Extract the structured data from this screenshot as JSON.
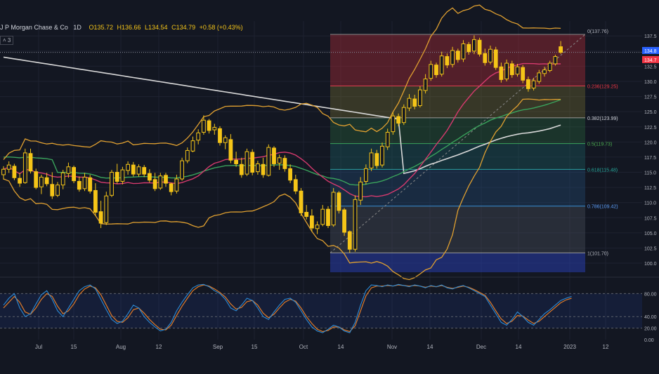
{
  "header": {
    "symbol": "J P Morgan Chase & Co",
    "interval": "1D",
    "open": "O135.72",
    "high": "H136.66",
    "low": "L134.54",
    "close": "C134.79",
    "change": "+0.58 (+0.43%)",
    "indicator_toggle": "˄ 3"
  },
  "colors": {
    "background": "#131722",
    "candle": "#f5c518",
    "bollinger": "#e0a030",
    "ma_fast": "#d63a6e",
    "ma_mid": "#3aa35c",
    "ma_slow": "#d8d8d8",
    "stoch_k": "#2d8bd6",
    "stoch_d": "#e07b2a",
    "price_tag_blue": "#2962ff",
    "price_tag_red": "#f23645"
  },
  "chart_data": [
    {
      "type": "candlestick",
      "title": "",
      "x_tick_labels": [
        "Jul",
        "15",
        "Aug",
        "12",
        "Sep",
        "15",
        "Oct",
        "14",
        "Nov",
        "14",
        "Dec",
        "14",
        "2023",
        "12"
      ],
      "y_tick_labels": [
        "100.0",
        "102.5",
        "105.0",
        "107.5",
        "110.0",
        "112.5",
        "115.0",
        "117.5",
        "120.0",
        "122.5",
        "125.0",
        "127.5",
        "130.0",
        "132.5",
        "135.0",
        "137.5"
      ],
      "ylim": [
        98.5,
        138.8
      ],
      "candles": [
        {
          "o": 114.6,
          "h": 116.0,
          "l": 113.8,
          "c": 115.5
        },
        {
          "o": 115.5,
          "h": 116.8,
          "l": 114.9,
          "c": 116.2
        },
        {
          "o": 116.0,
          "h": 116.4,
          "l": 113.7,
          "c": 114.1
        },
        {
          "o": 114.0,
          "h": 114.9,
          "l": 112.6,
          "c": 113.2
        },
        {
          "o": 113.3,
          "h": 118.9,
          "l": 113.1,
          "c": 118.2
        },
        {
          "o": 118.1,
          "h": 118.9,
          "l": 114.8,
          "c": 115.2
        },
        {
          "o": 115.1,
          "h": 115.6,
          "l": 112.2,
          "c": 112.5
        },
        {
          "o": 112.6,
          "h": 114.6,
          "l": 111.4,
          "c": 114.2
        },
        {
          "o": 114.1,
          "h": 114.9,
          "l": 112.7,
          "c": 113.1
        },
        {
          "o": 113.0,
          "h": 115.0,
          "l": 110.6,
          "c": 111.1
        },
        {
          "o": 111.2,
          "h": 113.4,
          "l": 110.9,
          "c": 112.9
        },
        {
          "o": 112.9,
          "h": 115.4,
          "l": 112.2,
          "c": 114.9
        },
        {
          "o": 114.8,
          "h": 116.6,
          "l": 114.1,
          "c": 115.9
        },
        {
          "o": 115.8,
          "h": 116.1,
          "l": 113.2,
          "c": 113.6
        },
        {
          "o": 113.5,
          "h": 114.3,
          "l": 111.8,
          "c": 112.2
        },
        {
          "o": 112.3,
          "h": 114.9,
          "l": 111.9,
          "c": 114.2
        },
        {
          "o": 114.1,
          "h": 114.6,
          "l": 111.5,
          "c": 111.9
        },
        {
          "o": 112.0,
          "h": 113.2,
          "l": 107.8,
          "c": 108.4
        },
        {
          "o": 108.5,
          "h": 110.3,
          "l": 105.8,
          "c": 106.6
        },
        {
          "o": 106.7,
          "h": 111.8,
          "l": 106.3,
          "c": 111.1
        },
        {
          "o": 111.2,
          "h": 115.4,
          "l": 110.9,
          "c": 115.0
        },
        {
          "o": 115.0,
          "h": 116.4,
          "l": 113.1,
          "c": 113.5
        },
        {
          "o": 113.5,
          "h": 115.9,
          "l": 113.0,
          "c": 115.4
        },
        {
          "o": 115.3,
          "h": 116.8,
          "l": 114.6,
          "c": 116.3
        },
        {
          "o": 116.2,
          "h": 116.7,
          "l": 114.3,
          "c": 114.7
        },
        {
          "o": 114.7,
          "h": 116.3,
          "l": 114.3,
          "c": 115.9
        },
        {
          "o": 115.8,
          "h": 116.2,
          "l": 114.2,
          "c": 114.7
        },
        {
          "o": 114.8,
          "h": 115.5,
          "l": 113.3,
          "c": 113.7
        },
        {
          "o": 113.8,
          "h": 114.9,
          "l": 111.9,
          "c": 112.3
        },
        {
          "o": 112.4,
          "h": 114.9,
          "l": 112.1,
          "c": 114.4
        },
        {
          "o": 114.5,
          "h": 114.9,
          "l": 112.6,
          "c": 113.2
        },
        {
          "o": 113.1,
          "h": 113.3,
          "l": 111.2,
          "c": 111.8
        },
        {
          "o": 111.9,
          "h": 114.6,
          "l": 111.5,
          "c": 113.9
        },
        {
          "o": 113.9,
          "h": 117.4,
          "l": 113.6,
          "c": 116.9
        },
        {
          "o": 116.9,
          "h": 119.1,
          "l": 116.5,
          "c": 118.6
        },
        {
          "o": 118.5,
          "h": 120.9,
          "l": 118.3,
          "c": 120.2
        },
        {
          "o": 120.3,
          "h": 122.1,
          "l": 119.6,
          "c": 121.5
        },
        {
          "o": 121.6,
          "h": 124.4,
          "l": 121.2,
          "c": 123.6
        },
        {
          "o": 123.5,
          "h": 123.8,
          "l": 121.4,
          "c": 121.9
        },
        {
          "o": 122.0,
          "h": 123.0,
          "l": 121.2,
          "c": 122.4
        },
        {
          "o": 122.2,
          "h": 122.6,
          "l": 119.4,
          "c": 119.9
        },
        {
          "o": 119.9,
          "h": 121.1,
          "l": 118.8,
          "c": 120.7
        },
        {
          "o": 120.4,
          "h": 121.3,
          "l": 116.5,
          "c": 117.0
        },
        {
          "o": 117.0,
          "h": 118.4,
          "l": 115.9,
          "c": 116.4
        },
        {
          "o": 116.3,
          "h": 117.4,
          "l": 114.1,
          "c": 114.6
        },
        {
          "o": 114.7,
          "h": 118.9,
          "l": 114.4,
          "c": 118.4
        },
        {
          "o": 118.3,
          "h": 118.8,
          "l": 114.5,
          "c": 115.0
        },
        {
          "o": 115.1,
          "h": 116.9,
          "l": 114.6,
          "c": 116.4
        },
        {
          "o": 116.3,
          "h": 117.4,
          "l": 114.1,
          "c": 114.6
        },
        {
          "o": 114.5,
          "h": 119.6,
          "l": 114.3,
          "c": 119.1
        },
        {
          "o": 119.0,
          "h": 119.3,
          "l": 115.9,
          "c": 116.4
        },
        {
          "o": 116.5,
          "h": 117.9,
          "l": 115.4,
          "c": 117.4
        },
        {
          "o": 117.3,
          "h": 117.8,
          "l": 115.1,
          "c": 115.6
        },
        {
          "o": 115.6,
          "h": 116.3,
          "l": 113.2,
          "c": 113.7
        },
        {
          "o": 113.8,
          "h": 114.6,
          "l": 111.4,
          "c": 111.9
        },
        {
          "o": 111.9,
          "h": 112.4,
          "l": 107.8,
          "c": 108.3
        },
        {
          "o": 108.4,
          "h": 109.6,
          "l": 107.2,
          "c": 107.7
        },
        {
          "o": 107.8,
          "h": 108.9,
          "l": 105.2,
          "c": 105.8
        },
        {
          "o": 105.7,
          "h": 106.9,
          "l": 104.8,
          "c": 106.3
        },
        {
          "o": 106.4,
          "h": 109.6,
          "l": 106.1,
          "c": 108.9
        },
        {
          "o": 108.9,
          "h": 109.4,
          "l": 105.8,
          "c": 106.2
        },
        {
          "o": 106.3,
          "h": 112.4,
          "l": 106.0,
          "c": 111.7
        },
        {
          "o": 111.6,
          "h": 111.9,
          "l": 108.2,
          "c": 108.7
        },
        {
          "o": 108.8,
          "h": 109.1,
          "l": 104.5,
          "c": 105.1
        },
        {
          "o": 105.2,
          "h": 105.4,
          "l": 101.7,
          "c": 102.3
        },
        {
          "o": 102.3,
          "h": 111.2,
          "l": 101.9,
          "c": 110.5
        },
        {
          "o": 110.4,
          "h": 114.2,
          "l": 109.6,
          "c": 113.4
        },
        {
          "o": 113.5,
          "h": 116.3,
          "l": 113.0,
          "c": 115.6
        },
        {
          "o": 115.7,
          "h": 118.9,
          "l": 115.2,
          "c": 118.2
        },
        {
          "o": 118.1,
          "h": 118.7,
          "l": 115.6,
          "c": 116.1
        },
        {
          "o": 116.2,
          "h": 119.9,
          "l": 115.8,
          "c": 119.3
        },
        {
          "o": 119.2,
          "h": 122.2,
          "l": 118.7,
          "c": 121.6
        },
        {
          "o": 121.7,
          "h": 124.9,
          "l": 121.2,
          "c": 124.3
        },
        {
          "o": 124.2,
          "h": 124.7,
          "l": 122.6,
          "c": 123.1
        },
        {
          "o": 123.2,
          "h": 126.2,
          "l": 122.8,
          "c": 125.7
        },
        {
          "o": 125.6,
          "h": 127.9,
          "l": 125.1,
          "c": 127.2
        },
        {
          "o": 127.1,
          "h": 127.8,
          "l": 125.4,
          "c": 125.9
        },
        {
          "o": 126.0,
          "h": 129.2,
          "l": 125.7,
          "c": 128.6
        },
        {
          "o": 128.5,
          "h": 131.2,
          "l": 128.0,
          "c": 130.4
        },
        {
          "o": 130.5,
          "h": 133.4,
          "l": 130.1,
          "c": 132.8
        },
        {
          "o": 132.7,
          "h": 133.1,
          "l": 130.6,
          "c": 131.1
        },
        {
          "o": 131.2,
          "h": 134.9,
          "l": 130.8,
          "c": 134.2
        },
        {
          "o": 134.1,
          "h": 134.6,
          "l": 132.2,
          "c": 132.7
        },
        {
          "o": 132.8,
          "h": 135.7,
          "l": 132.3,
          "c": 135.1
        },
        {
          "o": 135.0,
          "h": 135.4,
          "l": 133.1,
          "c": 133.6
        },
        {
          "o": 133.7,
          "h": 136.8,
          "l": 133.2,
          "c": 136.2
        },
        {
          "o": 136.1,
          "h": 136.5,
          "l": 134.4,
          "c": 134.9
        },
        {
          "o": 135.0,
          "h": 137.6,
          "l": 134.5,
          "c": 136.9
        },
        {
          "o": 136.8,
          "h": 137.2,
          "l": 134.1,
          "c": 134.5
        },
        {
          "o": 134.6,
          "h": 135.4,
          "l": 132.6,
          "c": 133.1
        },
        {
          "o": 133.2,
          "h": 135.9,
          "l": 132.8,
          "c": 135.3
        },
        {
          "o": 135.2,
          "h": 135.7,
          "l": 131.9,
          "c": 132.3
        },
        {
          "o": 132.4,
          "h": 133.1,
          "l": 129.8,
          "c": 130.3
        },
        {
          "o": 130.4,
          "h": 133.6,
          "l": 130.0,
          "c": 133.0
        },
        {
          "o": 132.9,
          "h": 133.4,
          "l": 130.6,
          "c": 131.1
        },
        {
          "o": 131.2,
          "h": 132.9,
          "l": 130.8,
          "c": 132.4
        },
        {
          "o": 132.3,
          "h": 132.7,
          "l": 129.7,
          "c": 130.2
        },
        {
          "o": 130.3,
          "h": 130.8,
          "l": 128.3,
          "c": 128.8
        },
        {
          "o": 128.9,
          "h": 130.6,
          "l": 128.5,
          "c": 130.1
        },
        {
          "o": 130.0,
          "h": 131.9,
          "l": 129.6,
          "c": 131.4
        },
        {
          "o": 131.3,
          "h": 132.4,
          "l": 130.8,
          "c": 131.9
        },
        {
          "o": 131.8,
          "h": 133.4,
          "l": 131.5,
          "c": 133.0
        },
        {
          "o": 132.9,
          "h": 134.4,
          "l": 132.6,
          "c": 134.1
        },
        {
          "o": 135.72,
          "h": 136.66,
          "l": 134.54,
          "c": 134.79
        }
      ],
      "fibonacci": [
        {
          "label": "0(137.76)",
          "value": 137.76
        },
        {
          "label": "0.236(129.25)",
          "value": 129.25
        },
        {
          "label": "0.382(123.99)",
          "value": 123.99
        },
        {
          "label": "0.5(119.73)",
          "value": 119.73
        },
        {
          "label": "0.618(115.48)",
          "value": 115.48
        },
        {
          "label": "0.786(109.42)",
          "value": 109.42
        },
        {
          "label": "1(101.70)",
          "value": 101.7
        }
      ],
      "price_tags": [
        {
          "text": "134.8",
          "value": 135.1,
          "color": "blue"
        },
        {
          "text": "134.7",
          "value": 133.6,
          "color": "red"
        }
      ]
    },
    {
      "type": "line",
      "title": "",
      "y_tick_labels": [
        "0.00",
        "20.00",
        "40.00",
        "80.00"
      ],
      "ylim": [
        0,
        100
      ],
      "series": [
        {
          "values": [
            60,
            72,
            80,
            55,
            40,
            45,
            62,
            78,
            85,
            70,
            50,
            40,
            55,
            70,
            85,
            92,
            95,
            88,
            70,
            52,
            35,
            28,
            32,
            45,
            60,
            55,
            40,
            30,
            22,
            15,
            18,
            30,
            50,
            65,
            78,
            90,
            95,
            96,
            92,
            85,
            80,
            70,
            55,
            50,
            60,
            72,
            68,
            55,
            40,
            35,
            48,
            60,
            70,
            72,
            65,
            50,
            35,
            22,
            15,
            12,
            18,
            25,
            22,
            15,
            12,
            30,
            60,
            85,
            95,
            94,
            92,
            95,
            93,
            96,
            94,
            92,
            95,
            93,
            90,
            94,
            92,
            95,
            90,
            88,
            92,
            94,
            90,
            85,
            80,
            75,
            60,
            45,
            30,
            25,
            35,
            48,
            40,
            30,
            25,
            35,
            45,
            52,
            60,
            68,
            72,
            75
          ]
        },
        {
          "values": [
            55,
            65,
            75,
            65,
            48,
            44,
            55,
            70,
            80,
            75,
            58,
            45,
            50,
            62,
            78,
            88,
            93,
            90,
            78,
            60,
            42,
            32,
            30,
            38,
            52,
            55,
            46,
            35,
            26,
            18,
            17,
            25,
            42,
            58,
            72,
            85,
            92,
            95,
            93,
            88,
            82,
            74,
            62,
            53,
            56,
            66,
            68,
            60,
            46,
            38,
            44,
            55,
            65,
            70,
            67,
            55,
            40,
            28,
            18,
            14,
            16,
            22,
            22,
            17,
            14,
            24,
            50,
            76,
            90,
            93,
            93,
            94,
            93,
            95,
            94,
            93,
            94,
            93,
            91,
            93,
            92,
            94,
            91,
            89,
            91,
            93,
            91,
            87,
            82,
            77,
            65,
            50,
            36,
            28,
            32,
            42,
            41,
            34,
            28,
            32,
            40,
            48,
            56,
            64,
            69,
            72
          ]
        }
      ]
    }
  ]
}
